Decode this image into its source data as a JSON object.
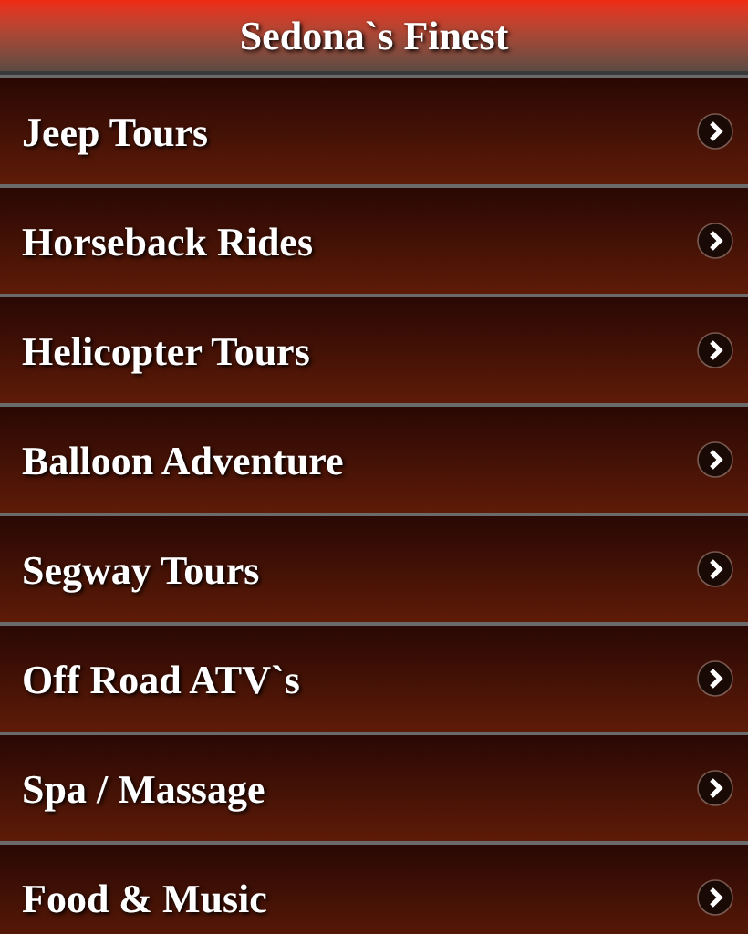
{
  "header": {
    "title": "Sedona`s Finest"
  },
  "menu": [
    {
      "label": "Jeep Tours"
    },
    {
      "label": "Horseback Rides"
    },
    {
      "label": "Helicopter Tours"
    },
    {
      "label": "Balloon Adventure"
    },
    {
      "label": "Segway Tours"
    },
    {
      "label": "Off Road ATV`s"
    },
    {
      "label": "Spa / Massage"
    },
    {
      "label": "Food & Music"
    }
  ]
}
